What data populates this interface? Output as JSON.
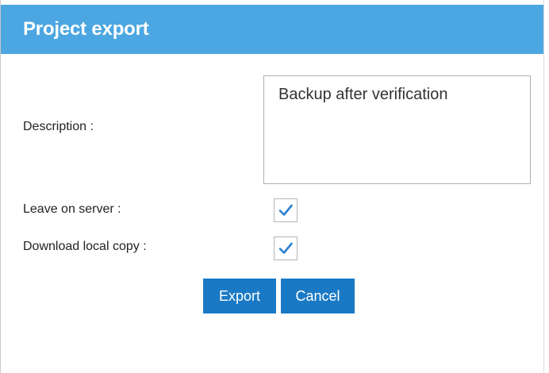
{
  "dialog": {
    "title": "Project export"
  },
  "form": {
    "description_label": "Description :",
    "description_value": "Backup after verification",
    "leave_on_server_label": "Leave on server :",
    "leave_on_server_checked": true,
    "download_local_copy_label": "Download local copy :",
    "download_local_copy_checked": true
  },
  "buttons": {
    "export_label": "Export",
    "cancel_label": "Cancel"
  },
  "colors": {
    "titlebar": "#4ba6e1",
    "button": "#1a79c4",
    "checkmark": "#2b7fd0"
  },
  "icons": {
    "checkbox_mark": "checkmark-icon"
  }
}
